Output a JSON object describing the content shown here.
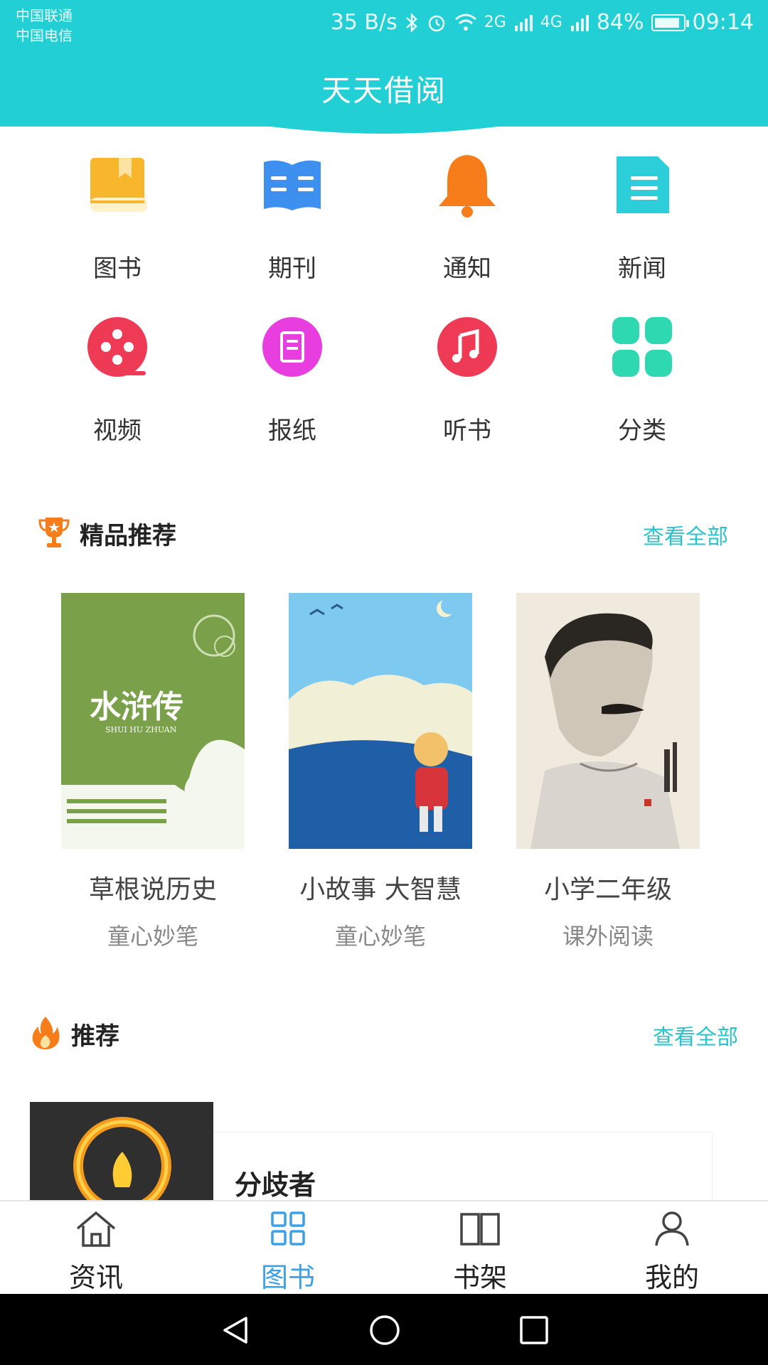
{
  "status_bar": {
    "carrier_1": "中国联通",
    "carrier_2": "中国电信",
    "net_speed": "35 B/s",
    "sig1_tag": "2G",
    "sig2_tag": "4G",
    "battery": "84%",
    "battery_level": 0.84,
    "time": "09:14"
  },
  "header": {
    "title": "天天借阅",
    "color": "#22cfd5"
  },
  "categories": [
    {
      "label": "图书",
      "icon": "book-icon"
    },
    {
      "label": "期刊",
      "icon": "open-book-icon"
    },
    {
      "label": "通知",
      "icon": "bell-icon"
    },
    {
      "label": "新闻",
      "icon": "document-icon"
    },
    {
      "label": "视频",
      "icon": "film-reel-icon"
    },
    {
      "label": "报纸",
      "icon": "newspaper-icon"
    },
    {
      "label": "听书",
      "icon": "music-note-icon"
    },
    {
      "label": "分类",
      "icon": "grid-icon"
    }
  ],
  "featured": {
    "title": "精品推荐",
    "more": "查看全部",
    "books": [
      {
        "title": "草根说历史",
        "subtitle": "童心妙笔",
        "cover_title": "水浒传",
        "cover_pinyin": "SHUI HU ZHUAN"
      },
      {
        "title": "小故事 大智慧",
        "subtitle": "童心妙笔"
      },
      {
        "title": "小学二年级",
        "subtitle": "课外阅读"
      }
    ]
  },
  "recommend": {
    "title": "推荐",
    "more": "查看全部",
    "item": {
      "title": "分歧者"
    }
  },
  "tabbar": {
    "items": [
      {
        "label": "资讯",
        "icon": "home-icon"
      },
      {
        "label": "图书",
        "icon": "grid-icon"
      },
      {
        "label": "书架",
        "icon": "open-book-icon"
      },
      {
        "label": "我的",
        "icon": "person-icon"
      }
    ],
    "active_color": "#3aa0e8"
  }
}
